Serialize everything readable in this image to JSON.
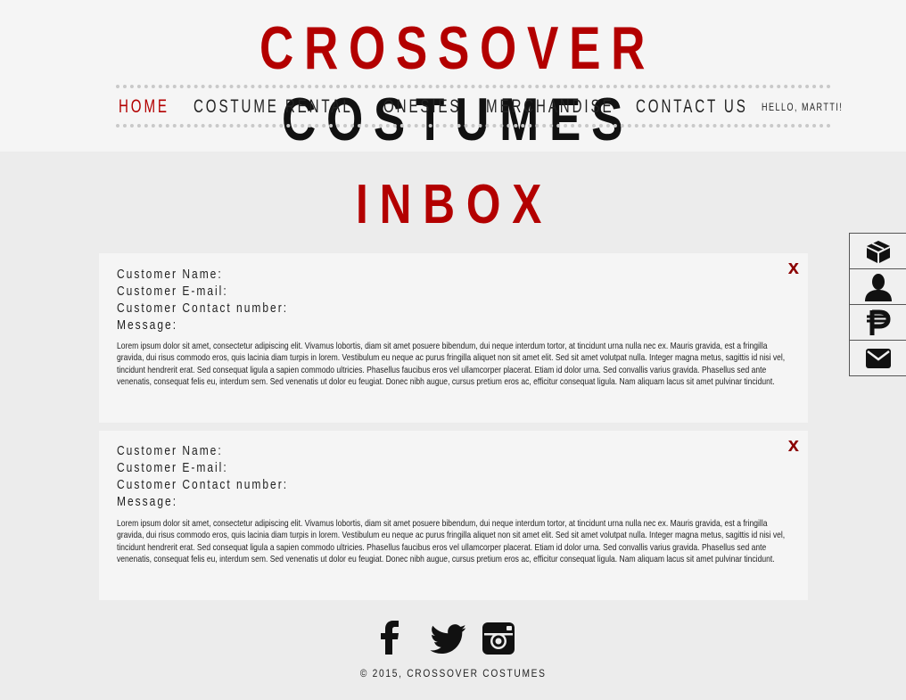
{
  "brand": {
    "word1": "CROSSOVER",
    "word2": "COSTUMES"
  },
  "nav": {
    "items": [
      {
        "label": "HOME",
        "active": true
      },
      {
        "label": "COSTUME RENTAL",
        "active": false
      },
      {
        "label": "ONESIES",
        "active": false
      },
      {
        "label": "MERCHANDISE",
        "active": false
      },
      {
        "label": "CONTACT US",
        "active": false
      }
    ],
    "greeting": "HELLO, MARTTI!"
  },
  "page_title": "INBOX",
  "messages": [
    {
      "name_label": "Customer Name:",
      "email_label": "Customer E-mail:",
      "contact_label": "Customer Contact number:",
      "message_label": "Message:",
      "body": "Lorem ipsum dolor sit amet, consectetur adipiscing elit. Vivamus lobortis, diam sit amet posuere bibendum, dui neque interdum tortor, at tincidunt urna nulla nec ex. Mauris gravida, est a fringilla gravida, dui risus commodo eros, quis lacinia diam turpis in lorem. Vestibulum eu neque ac purus fringilla aliquet non sit amet elit. Sed sit amet volutpat nulla. Integer magna metus, sagittis id nisi vel, tincidunt hendrerit erat. Sed consequat ligula a sapien commodo ultricies. Phasellus faucibus eros vel ullamcorper placerat. Etiam id dolor urna. Sed convallis varius gravida. Phasellus sed ante venenatis, consequat felis eu, interdum sem. Sed venenatis ut dolor eu feugiat. Donec nibh augue, cursus pretium eros ac, efficitur consequat ligula. Nam aliquam lacus sit amet pulvinar tincidunt.",
      "close": "x"
    },
    {
      "name_label": "Customer Name:",
      "email_label": "Customer E-mail:",
      "contact_label": "Customer Contact number:",
      "message_label": "Message:",
      "body": "Lorem ipsum dolor sit amet, consectetur adipiscing elit. Vivamus lobortis, diam sit amet posuere bibendum, dui neque interdum tortor, at tincidunt urna nulla nec ex. Mauris gravida, est a fringilla gravida, dui risus commodo eros, quis lacinia diam turpis in lorem. Vestibulum eu neque ac purus fringilla aliquet non sit amet elit. Sed sit amet volutpat nulla. Integer magna metus, sagittis id nisi vel, tincidunt hendrerit erat. Sed consequat ligula a sapien commodo ultricies. Phasellus faucibus eros vel ullamcorper placerat. Etiam id dolor urna. Sed convallis varius gravida. Phasellus sed ante venenatis, consequat felis eu, interdum sem. Sed venenatis ut dolor eu feugiat. Donec nibh augue, cursus pretium eros ac, efficitur consequat ligula. Nam aliquam lacus sit amet pulvinar tincidunt.",
      "close": "x"
    }
  ],
  "sidebar_icons": [
    "package-icon",
    "user-icon",
    "peso-icon",
    "mail-icon"
  ],
  "social_icons": [
    "facebook-icon",
    "twitter-icon",
    "instagram-icon"
  ],
  "footer": {
    "copyright": "© 2015, CROSSOVER COSTUMES"
  },
  "colors": {
    "accent": "#b30000",
    "close": "#8b0000",
    "text": "#222222",
    "background": "#ececec",
    "panel": "#f5f5f5"
  }
}
